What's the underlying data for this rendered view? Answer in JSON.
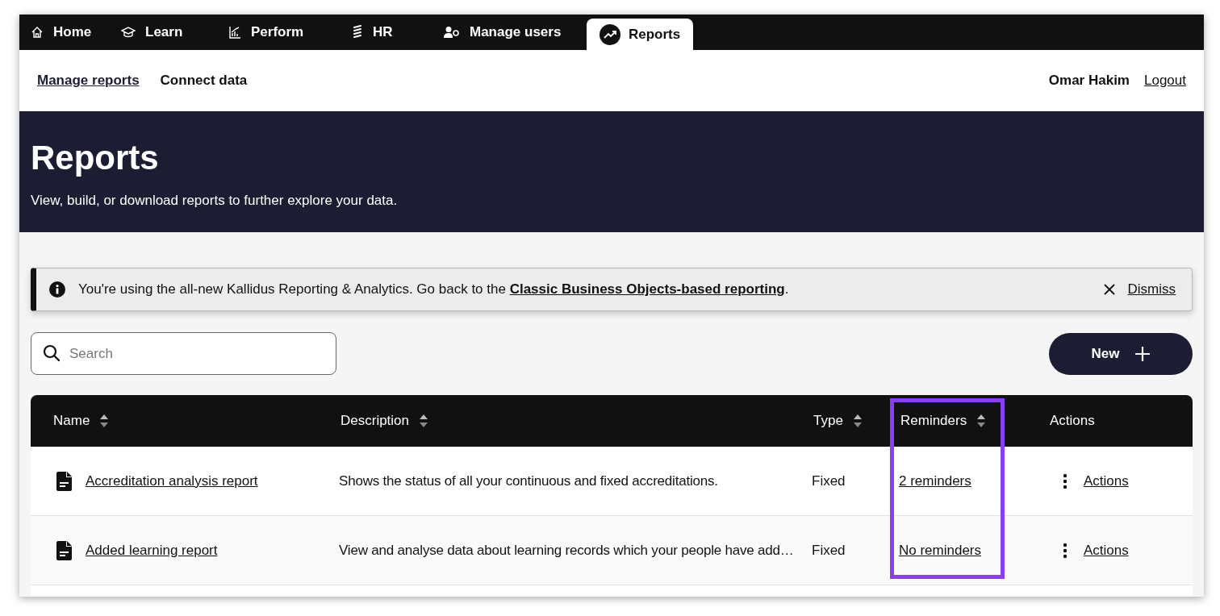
{
  "nav_tabs": [
    {
      "label": "Home",
      "kind": "home",
      "selected": false
    },
    {
      "label": "Learn",
      "kind": "learn",
      "selected": false
    },
    {
      "label": "Perform",
      "kind": "perform",
      "selected": false
    },
    {
      "label": "HR",
      "kind": "hr",
      "selected": false
    },
    {
      "label": "Manage users",
      "kind": "users",
      "selected": false
    },
    {
      "label": "Reports",
      "kind": "reports",
      "selected": true
    }
  ],
  "subnav": {
    "links": [
      {
        "label": "Manage reports",
        "selected": true
      },
      {
        "label": "Connect data",
        "selected": false
      }
    ],
    "user": "Omar Hakim",
    "logout": "Logout"
  },
  "header": {
    "title": "Reports",
    "subtitle": "View, build, or download reports to further explore your data."
  },
  "banner": {
    "text": "You're using the all-new Kallidus Reporting & Analytics. Go back to the ",
    "link": "Classic Business Objects-based reporting",
    "after": ".",
    "dismiss": "Dismiss"
  },
  "search": {
    "placeholder": "Search"
  },
  "new_button": "New",
  "table": {
    "columns": [
      {
        "label": "Name",
        "sortable": true,
        "highlighted": false
      },
      {
        "label": "Description",
        "sortable": true,
        "highlighted": false
      },
      {
        "label": "Type",
        "sortable": true,
        "highlighted": false
      },
      {
        "label": "Reminders",
        "sortable": true,
        "highlighted": true
      },
      {
        "label": "Actions",
        "sortable": false,
        "highlighted": false
      }
    ],
    "rows": [
      {
        "name": "Accreditation analysis report",
        "description": "Shows the status of all your continuous and fixed accreditations.",
        "type": "Fixed",
        "reminders": "2 reminders",
        "actions": "Actions"
      },
      {
        "name": "Added learning report",
        "description": "View and analyse data about learning records which your people have add…",
        "type": "Fixed",
        "reminders": "No reminders",
        "actions": "Actions"
      }
    ]
  }
}
